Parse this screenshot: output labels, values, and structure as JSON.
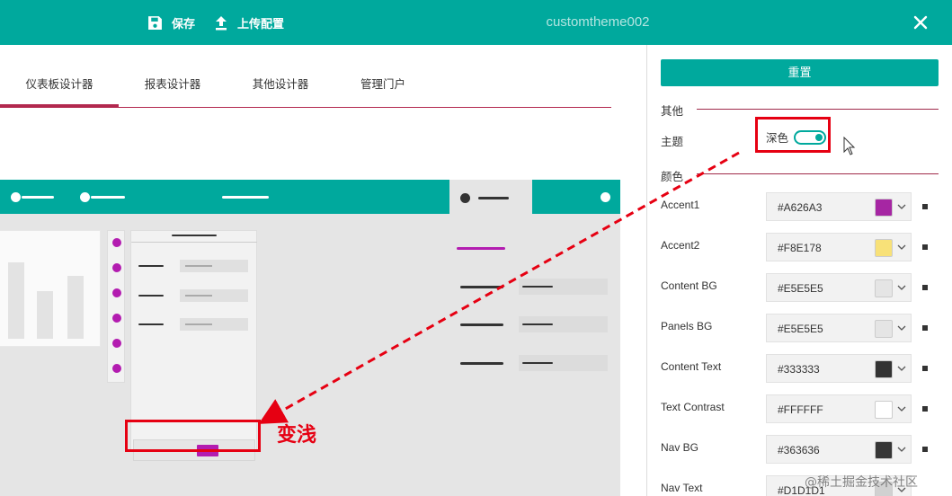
{
  "topbar": {
    "save_label": "保存",
    "upload_label": "上传配置",
    "title": "customtheme002",
    "save_icon": "save-icon",
    "upload_icon": "upload-icon",
    "close_icon": "close-icon"
  },
  "tabs": [
    {
      "label": "仪表板设计器",
      "active": true
    },
    {
      "label": "报表设计器",
      "active": false
    },
    {
      "label": "其他设计器",
      "active": false
    },
    {
      "label": "管理门户",
      "active": false
    }
  ],
  "annotation": {
    "label": "变浅",
    "color": "#e60012"
  },
  "settings": {
    "reset_label": "重置",
    "section_other": "其他",
    "theme_label": "主题",
    "theme_toggle_label": "深色",
    "theme_dark": true,
    "section_color": "颜色"
  },
  "colors": [
    {
      "label": "Accent1",
      "value": "#A626A3",
      "swatch": "#A626A3"
    },
    {
      "label": "Accent2",
      "value": "#F8E178",
      "swatch": "#F8E178"
    },
    {
      "label": "Content BG",
      "value": "#E5E5E5",
      "swatch": "#E5E5E5"
    },
    {
      "label": "Panels BG",
      "value": "#E5E5E5",
      "swatch": "#E5E5E5"
    },
    {
      "label": "Content Text",
      "value": "#333333",
      "swatch": "#333333"
    },
    {
      "label": "Text Contrast",
      "value": "#FFFFFF",
      "swatch": "#FFFFFF"
    },
    {
      "label": "Nav BG",
      "value": "#363636",
      "swatch": "#363636"
    },
    {
      "label": "Nav Text",
      "value": "#D1D1D1",
      "swatch": "#D1D1D1"
    }
  ],
  "theme_colors": {
    "header": "#00a99d",
    "accent": "#b2284e",
    "highlight": "#e60012"
  },
  "watermark": "@稀土掘金技术社区"
}
